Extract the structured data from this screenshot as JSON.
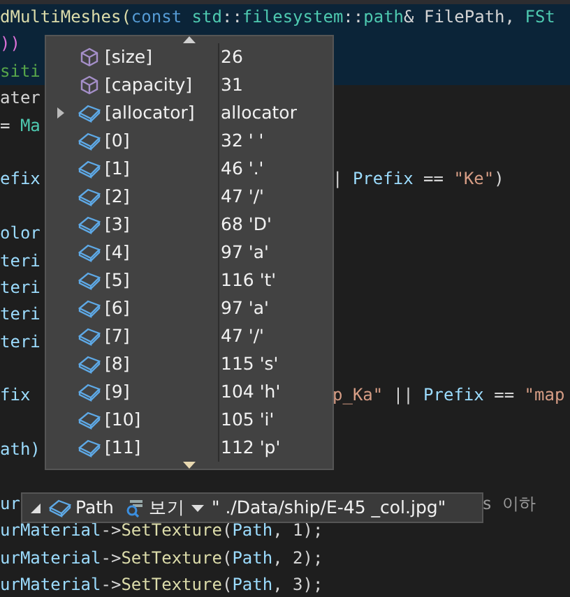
{
  "code_lines": [
    {
      "kind": "code",
      "left": [
        {
          "text": "dMultiMeshes(",
          "color": "#dcdcaa"
        },
        {
          "text": "const ",
          "color": "#569cd6"
        },
        {
          "text": "std",
          "color": "#4ec9b0"
        },
        {
          "text": "::",
          "color": "#d4d4d4"
        },
        {
          "text": "filesystem",
          "color": "#4ec9b0"
        },
        {
          "text": "::",
          "color": "#d4d4d4"
        },
        {
          "text": "path",
          "color": "#4ec9b0"
        },
        {
          "text": "& FilePath, ",
          "color": "#d4d4d4"
        },
        {
          "text": "FSt",
          "color": "#4ec9b0"
        }
      ],
      "highlight": true
    },
    {
      "kind": "code",
      "left": [
        {
          "text": "))",
          "color": "#da70d6"
        }
      ],
      "highlight": true
    },
    {
      "kind": "code",
      "left": [
        {
          "text": "siti",
          "color": "#57a64a"
        }
      ],
      "highlight": true
    },
    {
      "kind": "code",
      "left": [
        {
          "text": "ater",
          "color": "#d4d4d4"
        }
      ]
    },
    {
      "kind": "code",
      "left": [
        {
          "text": "= ",
          "color": "#d4d4d4"
        },
        {
          "text": "Ma",
          "color": "#4ec9b0"
        }
      ]
    },
    {
      "kind": "blank"
    },
    {
      "kind": "code",
      "left": [
        {
          "text": "efix",
          "color": "#9cdcfe"
        }
      ],
      "right": [
        {
          "text": "| ",
          "color": "#d4d4d4"
        },
        {
          "text": "Prefix",
          "color": "#9cdcfe"
        },
        {
          "text": " == ",
          "color": "#d4d4d4"
        },
        {
          "text": "\"Ke\"",
          "color": "#d69d85"
        },
        {
          "text": ")",
          "color": "#d4d4d4"
        }
      ]
    },
    {
      "kind": "blank"
    },
    {
      "kind": "code",
      "left": [
        {
          "text": "olor",
          "color": "#9cdcfe"
        }
      ]
    },
    {
      "kind": "code",
      "left": [
        {
          "text": "teri",
          "color": "#9cdcfe"
        }
      ]
    },
    {
      "kind": "code",
      "left": [
        {
          "text": "teri",
          "color": "#9cdcfe"
        }
      ]
    },
    {
      "kind": "code",
      "left": [
        {
          "text": "teri",
          "color": "#9cdcfe"
        }
      ]
    },
    {
      "kind": "code",
      "left": [
        {
          "text": "teri",
          "color": "#9cdcfe"
        }
      ]
    },
    {
      "kind": "blank"
    },
    {
      "kind": "code",
      "left": [
        {
          "text": "fix",
          "color": "#9cdcfe"
        }
      ],
      "right": [
        {
          "text": "p_Ka\"",
          "color": "#d69d85"
        },
        {
          "text": " || ",
          "color": "#d4d4d4"
        },
        {
          "text": "Prefix",
          "color": "#9cdcfe"
        },
        {
          "text": " == ",
          "color": "#d4d4d4"
        },
        {
          "text": "\"map",
          "color": "#d69d85"
        }
      ]
    },
    {
      "kind": "blank"
    },
    {
      "kind": "code",
      "left": [
        {
          "text": "ath)",
          "color": "#9cdcfe"
        }
      ]
    },
    {
      "kind": "blank"
    },
    {
      "kind": "code",
      "left": [
        {
          "text": "ur",
          "color": "#9cdcfe"
        }
      ],
      "right": [
        {
          "text": "s 이하",
          "color": "#9a9a9a"
        }
      ]
    },
    {
      "kind": "code",
      "left": [
        {
          "text": "urMaterial",
          "color": "#9cdcfe"
        },
        {
          "text": "->",
          "color": "#d4d4d4"
        },
        {
          "text": "SetTexture",
          "color": "#dcdcaa"
        },
        {
          "text": "(",
          "color": "#d4d4d4"
        },
        {
          "text": "Path",
          "color": "#9cdcfe"
        },
        {
          "text": ", 1);",
          "color": "#d4d4d4"
        }
      ]
    },
    {
      "kind": "code",
      "left": [
        {
          "text": "urMaterial",
          "color": "#9cdcfe"
        },
        {
          "text": "->",
          "color": "#d4d4d4"
        },
        {
          "text": "SetTexture",
          "color": "#dcdcaa"
        },
        {
          "text": "(",
          "color": "#d4d4d4"
        },
        {
          "text": "Path",
          "color": "#9cdcfe"
        },
        {
          "text": ", 2);",
          "color": "#d4d4d4"
        }
      ]
    },
    {
      "kind": "code",
      "left": [
        {
          "text": "urMaterial",
          "color": "#9cdcfe"
        },
        {
          "text": "->",
          "color": "#d4d4d4"
        },
        {
          "text": "SetTexture",
          "color": "#dcdcaa"
        },
        {
          "text": "(",
          "color": "#d4d4d4"
        },
        {
          "text": "Path",
          "color": "#9cdcfe"
        },
        {
          "text": ", 3);",
          "color": "#d4d4d4"
        }
      ]
    }
  ],
  "watch_popup": {
    "rows": [
      {
        "kind": "property",
        "expandable": false,
        "name": "[size]",
        "value": "26"
      },
      {
        "kind": "property",
        "expandable": false,
        "name": "[capacity]",
        "value": "31"
      },
      {
        "kind": "field",
        "expandable": true,
        "name": "[allocator]",
        "value": "allocator"
      },
      {
        "kind": "field",
        "expandable": false,
        "name": "[0]",
        "value": "32 ' '"
      },
      {
        "kind": "field",
        "expandable": false,
        "name": "[1]",
        "value": "46 '.'"
      },
      {
        "kind": "field",
        "expandable": false,
        "name": "[2]",
        "value": "47 '/'"
      },
      {
        "kind": "field",
        "expandable": false,
        "name": "[3]",
        "value": "68 'D'"
      },
      {
        "kind": "field",
        "expandable": false,
        "name": "[4]",
        "value": "97 'a'"
      },
      {
        "kind": "field",
        "expandable": false,
        "name": "[5]",
        "value": "116 't'"
      },
      {
        "kind": "field",
        "expandable": false,
        "name": "[6]",
        "value": "97 'a'"
      },
      {
        "kind": "field",
        "expandable": false,
        "name": "[7]",
        "value": "47 '/'"
      },
      {
        "kind": "field",
        "expandable": false,
        "name": "[8]",
        "value": "115 's'"
      },
      {
        "kind": "field",
        "expandable": false,
        "name": "[9]",
        "value": "104 'h'"
      },
      {
        "kind": "field",
        "expandable": false,
        "name": "[10]",
        "value": "105 'i'"
      },
      {
        "kind": "field",
        "expandable": false,
        "name": "[11]",
        "value": "112 'p'"
      }
    ]
  },
  "data_tip": {
    "expanded": true,
    "name": "Path",
    "view_label": "보기",
    "value": "\" ./Data/ship/E-45 _col.jpg\""
  }
}
